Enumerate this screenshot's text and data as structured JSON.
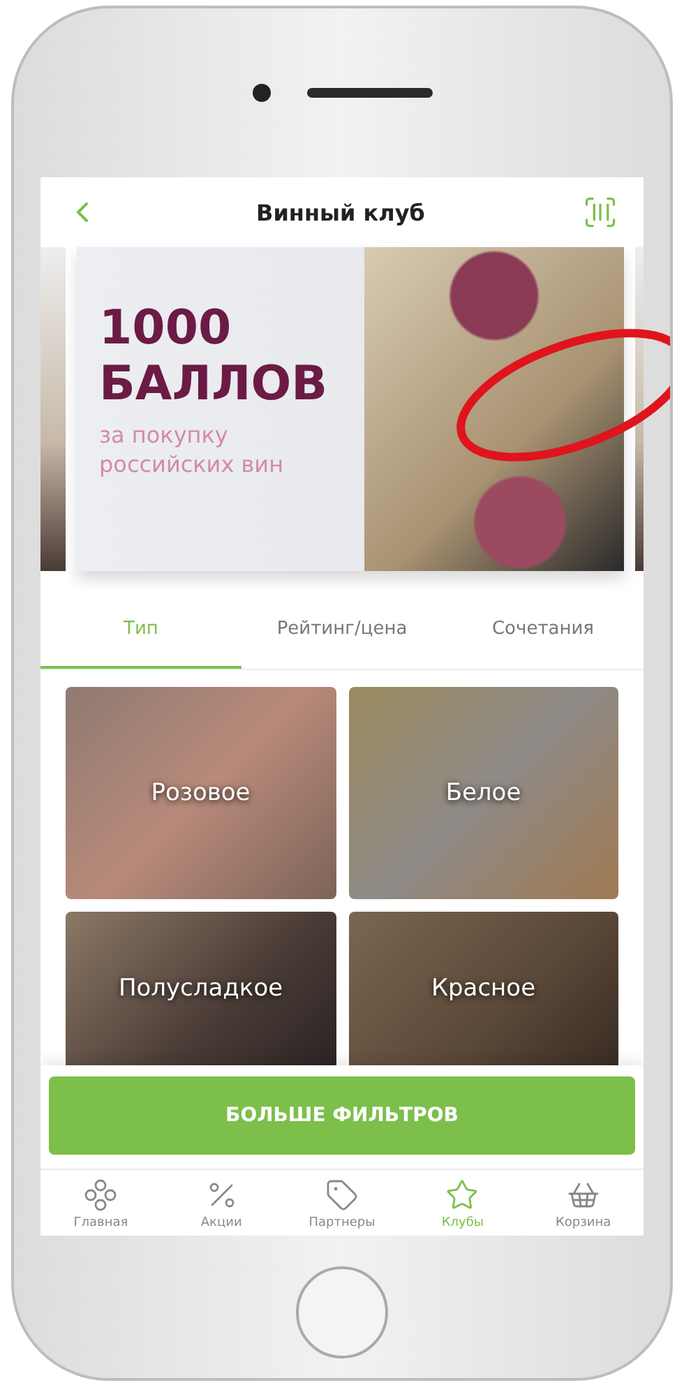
{
  "header": {
    "title": "Винный клуб"
  },
  "banner": {
    "headline": [
      "1000",
      "БАЛЛОВ"
    ],
    "subtitle": "за покупку российских вин"
  },
  "tabs": [
    {
      "label": "Тип",
      "selected": true
    },
    {
      "label": "Рейтинг/цена",
      "selected": false
    },
    {
      "label": "Сочетания",
      "selected": false
    }
  ],
  "categories": [
    {
      "label": "Розовое"
    },
    {
      "label": "Белое"
    },
    {
      "label": "Полусладкое"
    },
    {
      "label": "Красное"
    }
  ],
  "filter_button": {
    "label": "БОЛЬШЕ ФИЛЬТРОВ"
  },
  "nav": [
    {
      "kind": "home",
      "label": "Главная",
      "selected": false
    },
    {
      "kind": "percent",
      "label": "Акции",
      "selected": false
    },
    {
      "kind": "tag",
      "label": "Партнеры",
      "selected": false
    },
    {
      "kind": "star",
      "label": "Клубы",
      "selected": true
    },
    {
      "kind": "basket",
      "label": "Корзина",
      "selected": false
    }
  ]
}
